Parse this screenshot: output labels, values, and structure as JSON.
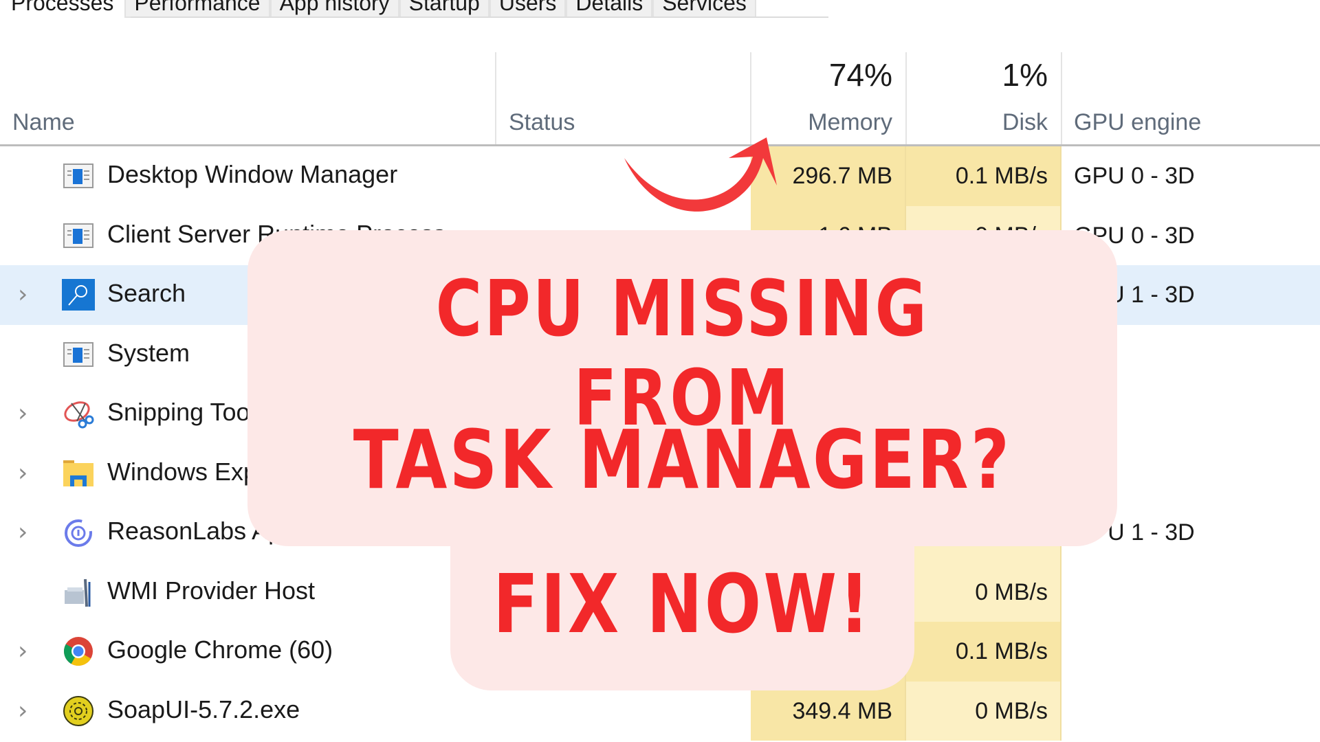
{
  "tabs": [
    {
      "label": "Processes",
      "active": true
    },
    {
      "label": "Performance",
      "active": false
    },
    {
      "label": "App history",
      "active": false
    },
    {
      "label": "Startup",
      "active": false
    },
    {
      "label": "Users",
      "active": false
    },
    {
      "label": "Details",
      "active": false
    },
    {
      "label": "Services",
      "active": false
    }
  ],
  "columns": {
    "name": "Name",
    "status": "Status",
    "memory": {
      "label": "Memory",
      "percent": "74%"
    },
    "disk": {
      "label": "Disk",
      "percent": "1%"
    },
    "gpu_engine": "GPU engine"
  },
  "processes": [
    {
      "name": "Desktop Window Manager",
      "icon": "window-app-icon",
      "expandable": false,
      "selected": false,
      "memory": "296.7 MB",
      "disk": "0.1 MB/s",
      "gpu_engine": "GPU 0 - 3D"
    },
    {
      "name": "Client Server Runtime Process",
      "icon": "window-app-icon",
      "expandable": false,
      "selected": false,
      "memory": "1.6 MB",
      "disk": "0 MB/s",
      "gpu_engine": "GPU 0 - 3D"
    },
    {
      "name": "Search",
      "icon": "search-app-icon",
      "expandable": true,
      "selected": true,
      "memory": "",
      "disk": "",
      "gpu_engine": "GPU 1 - 3D"
    },
    {
      "name": "System",
      "icon": "window-app-icon",
      "expandable": false,
      "selected": false,
      "memory": "",
      "disk": "",
      "gpu_engine": ""
    },
    {
      "name": "Snipping Tool",
      "icon": "snipping-tool-icon",
      "expandable": true,
      "selected": false,
      "memory": "",
      "disk": "",
      "gpu_engine": ""
    },
    {
      "name": "Windows Explorer",
      "icon": "file-explorer-icon",
      "expandable": true,
      "selected": false,
      "memory": "",
      "disk": "",
      "gpu_engine": ""
    },
    {
      "name": "ReasonLabs App",
      "icon": "reasonlabs-icon",
      "expandable": true,
      "selected": false,
      "memory": "",
      "disk": "",
      "gpu_engine": "GPU 1 - 3D"
    },
    {
      "name": "WMI Provider Host",
      "icon": "wmi-provider-icon",
      "expandable": false,
      "selected": false,
      "memory": "",
      "disk": "0 MB/s",
      "gpu_engine": ""
    },
    {
      "name": "Google Chrome (60)",
      "icon": "chrome-icon",
      "expandable": true,
      "selected": false,
      "memory": "",
      "disk": "0.1 MB/s",
      "gpu_engine": ""
    },
    {
      "name": "SoapUI-5.7.2.exe",
      "icon": "soapui-icon",
      "expandable": true,
      "selected": false,
      "memory": "349.4 MB",
      "disk": "0 MB/s",
      "gpu_engine": ""
    }
  ],
  "overlay": {
    "line1": "CPU MISSING FROM",
    "line2": "TASK MANAGER?",
    "line3": "FIX NOW!",
    "text_color": "#f2282a",
    "card_color": "#fde8e7",
    "arrow_icon": "curved-arrow-icon"
  },
  "colors": {
    "memory_heat": "#f8e6a6",
    "disk_heat": "#fcf0c4",
    "selected_row": "#e3effb",
    "header_label": "#5f6b7a"
  }
}
